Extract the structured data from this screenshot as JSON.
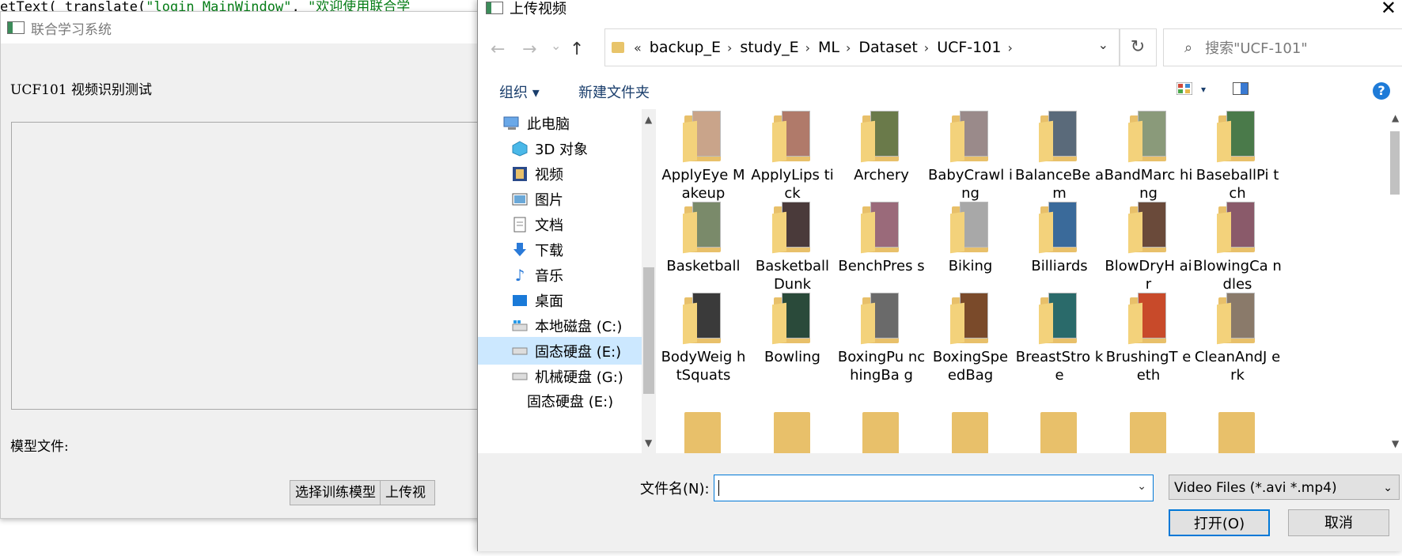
{
  "code_line": {
    "prefix": "etText(_translate(",
    "str1": "\"login_MainWindow\"",
    "mid": ", ",
    "str2": "\"欢迎使用联合学"
  },
  "bg_window": {
    "title": "联合学习系统",
    "heading": "UCF101 视频识别测试",
    "model_label": "模型文件:",
    "btn_select": "选择训练模型",
    "btn_upload": "上传视"
  },
  "dialog": {
    "title": "上传视频",
    "close": "✕",
    "nav": {
      "back": "←",
      "forward": "→",
      "recent": "⌄",
      "up": "↑"
    },
    "breadcrumb": {
      "overflow": "«",
      "segments": [
        "backup_E",
        "study_E",
        "ML",
        "Dataset",
        "UCF-101"
      ],
      "sep": "›"
    },
    "search_placeholder": "搜索\"UCF-101\"",
    "toolbar": {
      "organize": "组织 ▾",
      "new_folder": "新建文件夹",
      "help": "?"
    },
    "nav_items": [
      {
        "label": "此电脑",
        "icon": "pc-icon"
      },
      {
        "label": "3D 对象",
        "icon": "cube-icon"
      },
      {
        "label": "视频",
        "icon": "video-icon"
      },
      {
        "label": "图片",
        "icon": "picture-icon"
      },
      {
        "label": "文档",
        "icon": "document-icon"
      },
      {
        "label": "下载",
        "icon": "download-icon"
      },
      {
        "label": "音乐",
        "icon": "music-icon"
      },
      {
        "label": "桌面",
        "icon": "desktop-icon"
      },
      {
        "label": "本地磁盘 (C:)",
        "icon": "drive-c-icon"
      },
      {
        "label": "固态硬盘 (E:)",
        "icon": "drive-e-icon"
      },
      {
        "label": "机械硬盘 (G:)",
        "icon": "drive-g-icon"
      },
      {
        "label": "固态硬盘 (E:)",
        "icon": "drive-e2-icon"
      }
    ],
    "folders": [
      {
        "name": "ApplyEye Makeup",
        "color": "#c9a48a"
      },
      {
        "name": "ApplyLips tick",
        "color": "#b07a6a"
      },
      {
        "name": "Archery",
        "color": "#6a7a4a"
      },
      {
        "name": "BabyCrawl ing",
        "color": "#9a8a8a"
      },
      {
        "name": "BalanceBe am",
        "color": "#5a6a7a"
      },
      {
        "name": "BandMarc hing",
        "color": "#8a9a7a"
      },
      {
        "name": "BaseballPi tch",
        "color": "#4a7a4a"
      },
      {
        "name": "Basketball",
        "color": "#7a8a6a"
      },
      {
        "name": "Basketball Dunk",
        "color": "#4a3a3a"
      },
      {
        "name": "BenchPres s",
        "color": "#9a6a7a"
      },
      {
        "name": "Biking",
        "color": "#a8a8a8"
      },
      {
        "name": "Billiards",
        "color": "#3a6a9a"
      },
      {
        "name": "BlowDryH air",
        "color": "#6a4a3a"
      },
      {
        "name": "BlowingCa ndles",
        "color": "#8a5a6a"
      },
      {
        "name": "BodyWeig htSquats",
        "color": "#3a3a3a"
      },
      {
        "name": "Bowling",
        "color": "#2a4a3a"
      },
      {
        "name": "BoxingPu nchingBa g",
        "color": "#6a6a6a"
      },
      {
        "name": "BoxingSpe edBag",
        "color": "#7a4a2a"
      },
      {
        "name": "BreastStro ke",
        "color": "#2a6a6a"
      },
      {
        "name": "BrushingT eeth",
        "color": "#c84a2a"
      },
      {
        "name": "CleanAndJ erk",
        "color": "#8a7a6a"
      }
    ],
    "filename_label": "文件名(N):",
    "filename_value": "",
    "filter_value": "Video Files (*.avi *.mp4)",
    "btn_open": "打开(O)",
    "btn_cancel": "取消"
  },
  "colors": {
    "accent": "#0078d7",
    "folder": "#e8c06a",
    "selected": "#cce8ff"
  }
}
